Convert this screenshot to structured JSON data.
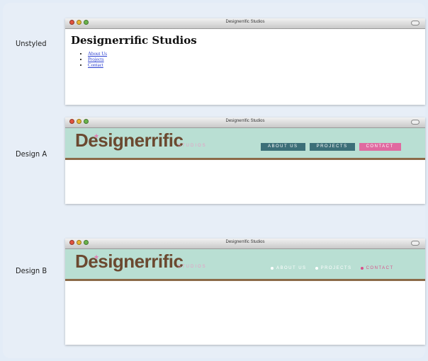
{
  "windows": [
    {
      "label": "Unstyled",
      "title": "Designerrific Studios",
      "heading": "Designerrific Studios",
      "links": [
        "About Us",
        "Projects",
        "Contact"
      ]
    },
    {
      "label": "Design A",
      "title": "Designerrific Studios",
      "logo": "Designerrific",
      "studios": "STUDIOS",
      "nav": [
        "ABOUT US",
        "PROJECTS",
        "CONTACT"
      ]
    },
    {
      "label": "Design B",
      "title": "Designerrific Studios",
      "logo": "Designerrific",
      "studios": "STUDIOS",
      "nav": [
        "ABOUT US",
        "PROJECTS",
        "CONTACT"
      ]
    }
  ],
  "colors": {
    "header_bg": "#b9dfd3",
    "logo": "#6b4930",
    "accent_pink": "#e06aa0",
    "nav_teal": "#3c6f78"
  }
}
